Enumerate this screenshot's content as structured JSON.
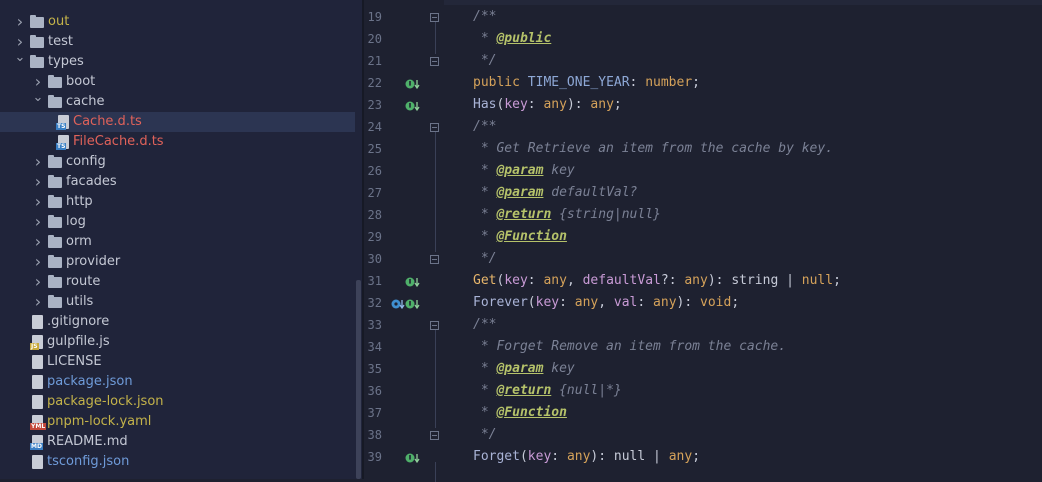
{
  "tree": {
    "items": [
      {
        "label": "out",
        "kind": "folder",
        "depth": 0,
        "expanded": false,
        "color": "#c4b34a"
      },
      {
        "label": "test",
        "kind": "folder",
        "depth": 0,
        "expanded": false,
        "color": "#c4c8d4"
      },
      {
        "label": "types",
        "kind": "folder",
        "depth": 0,
        "expanded": true,
        "color": "#c4c8d4"
      },
      {
        "label": "boot",
        "kind": "folder",
        "depth": 1,
        "expanded": false,
        "color": "#c4c8d4"
      },
      {
        "label": "cache",
        "kind": "folder",
        "depth": 1,
        "expanded": true,
        "color": "#c4c8d4"
      },
      {
        "label": "Cache.d.ts",
        "kind": "ts",
        "depth": 2,
        "color": "#e0625a",
        "selected": true
      },
      {
        "label": "FileCache.d.ts",
        "kind": "ts",
        "depth": 2,
        "color": "#e0625a"
      },
      {
        "label": "config",
        "kind": "folder",
        "depth": 1,
        "expanded": false,
        "color": "#c4c8d4"
      },
      {
        "label": "facades",
        "kind": "folder",
        "depth": 1,
        "expanded": false,
        "color": "#c4c8d4"
      },
      {
        "label": "http",
        "kind": "folder",
        "depth": 1,
        "expanded": false,
        "color": "#c4c8d4"
      },
      {
        "label": "log",
        "kind": "folder",
        "depth": 1,
        "expanded": false,
        "color": "#c4c8d4"
      },
      {
        "label": "orm",
        "kind": "folder",
        "depth": 1,
        "expanded": false,
        "color": "#c4c8d4"
      },
      {
        "label": "provider",
        "kind": "folder",
        "depth": 1,
        "expanded": false,
        "color": "#c4c8d4"
      },
      {
        "label": "route",
        "kind": "folder",
        "depth": 1,
        "expanded": false,
        "color": "#c4c8d4"
      },
      {
        "label": "utils",
        "kind": "folder",
        "depth": 1,
        "expanded": false,
        "color": "#c4c8d4"
      },
      {
        "label": ".gitignore",
        "kind": "file",
        "depth": 0,
        "color": "#c4c8d4"
      },
      {
        "label": "gulpfile.js",
        "kind": "js",
        "depth": 0,
        "color": "#c4c8d4"
      },
      {
        "label": "LICENSE",
        "kind": "file",
        "depth": 0,
        "color": "#c4c8d4"
      },
      {
        "label": "package.json",
        "kind": "json",
        "depth": 0,
        "color": "#6f9bd9"
      },
      {
        "label": "package-lock.json",
        "kind": "json",
        "depth": 0,
        "color": "#c4b34a"
      },
      {
        "label": "pnpm-lock.yaml",
        "kind": "yml",
        "depth": 0,
        "color": "#c4b34a"
      },
      {
        "label": "README.md",
        "kind": "md",
        "depth": 0,
        "color": "#c4c8d4"
      },
      {
        "label": "tsconfig.json",
        "kind": "json",
        "depth": 0,
        "color": "#6f9bd9"
      }
    ],
    "badges": {
      "ts": "TS",
      "js": "JS",
      "yml": "YML",
      "md": "MD"
    }
  },
  "editor": {
    "line_numbers": [
      "19",
      "20",
      "21",
      "22",
      "23",
      "24",
      "25",
      "26",
      "27",
      "28",
      "29",
      "30",
      "31",
      "32",
      "33",
      "34",
      "35",
      "36",
      "37",
      "38",
      "39"
    ],
    "lines": [
      [
        {
          "t": "/**",
          "c": "c-com"
        }
      ],
      [
        {
          "t": " * ",
          "c": "c-com"
        },
        {
          "t": "@public",
          "c": "c-tag"
        }
      ],
      [
        {
          "t": " */",
          "c": "c-com"
        }
      ],
      [
        {
          "t": "public ",
          "c": "c-kw"
        },
        {
          "t": "TIME_ONE_YEAR",
          "c": "c-name"
        },
        {
          "t": ": ",
          "c": "c-plain"
        },
        {
          "t": "number",
          "c": "c-type"
        },
        {
          "t": ";",
          "c": "c-plain"
        }
      ],
      [
        {
          "t": "Has",
          "c": "c-meth"
        },
        {
          "t": "(",
          "c": "c-plain"
        },
        {
          "t": "key",
          "c": "c-param"
        },
        {
          "t": ": ",
          "c": "c-plain"
        },
        {
          "t": "any",
          "c": "c-type"
        },
        {
          "t": "): ",
          "c": "c-plain"
        },
        {
          "t": "any",
          "c": "c-type"
        },
        {
          "t": ";",
          "c": "c-plain"
        }
      ],
      [
        {
          "t": "/**",
          "c": "c-com"
        }
      ],
      [
        {
          "t": " * Get Retrieve an item from the cache by key.",
          "c": "c-com"
        }
      ],
      [
        {
          "t": " * ",
          "c": "c-com"
        },
        {
          "t": "@param",
          "c": "c-tag"
        },
        {
          "t": " key",
          "c": "c-ital"
        }
      ],
      [
        {
          "t": " * ",
          "c": "c-com"
        },
        {
          "t": "@param",
          "c": "c-tag"
        },
        {
          "t": " defaultVal?",
          "c": "c-ital"
        }
      ],
      [
        {
          "t": " * ",
          "c": "c-com"
        },
        {
          "t": "@return",
          "c": "c-tag"
        },
        {
          "t": " {string|null}",
          "c": "c-ital"
        }
      ],
      [
        {
          "t": " * ",
          "c": "c-com"
        },
        {
          "t": "@Function",
          "c": "c-tag"
        }
      ],
      [
        {
          "t": " */",
          "c": "c-com"
        }
      ],
      [
        {
          "t": "Get",
          "c": "c-fn"
        },
        {
          "t": "(",
          "c": "c-plain"
        },
        {
          "t": "key",
          "c": "c-param"
        },
        {
          "t": ": ",
          "c": "c-plain"
        },
        {
          "t": "any",
          "c": "c-type"
        },
        {
          "t": ", ",
          "c": "c-plain"
        },
        {
          "t": "defaultVal",
          "c": "c-param"
        },
        {
          "t": "?: ",
          "c": "c-plain"
        },
        {
          "t": "any",
          "c": "c-type"
        },
        {
          "t": "): ",
          "c": "c-plain"
        },
        {
          "t": "string",
          "c": "c-plain"
        },
        {
          "t": " | ",
          "c": "c-plain"
        },
        {
          "t": "null",
          "c": "c-type"
        },
        {
          "t": ";",
          "c": "c-plain"
        }
      ],
      [
        {
          "t": "Forever",
          "c": "c-meth"
        },
        {
          "t": "(",
          "c": "c-plain"
        },
        {
          "t": "key",
          "c": "c-param"
        },
        {
          "t": ": ",
          "c": "c-plain"
        },
        {
          "t": "any",
          "c": "c-type"
        },
        {
          "t": ", ",
          "c": "c-plain"
        },
        {
          "t": "val",
          "c": "c-param"
        },
        {
          "t": ": ",
          "c": "c-plain"
        },
        {
          "t": "any",
          "c": "c-type"
        },
        {
          "t": "): ",
          "c": "c-plain"
        },
        {
          "t": "void",
          "c": "c-type"
        },
        {
          "t": ";",
          "c": "c-plain"
        }
      ],
      [
        {
          "t": "/**",
          "c": "c-com"
        }
      ],
      [
        {
          "t": " * Forget Remove an item from the cache.",
          "c": "c-com"
        }
      ],
      [
        {
          "t": " * ",
          "c": "c-com"
        },
        {
          "t": "@param",
          "c": "c-tag"
        },
        {
          "t": " key",
          "c": "c-ital"
        }
      ],
      [
        {
          "t": " * ",
          "c": "c-com"
        },
        {
          "t": "@return",
          "c": "c-tag"
        },
        {
          "t": " {null|*}",
          "c": "c-ital"
        }
      ],
      [
        {
          "t": " * ",
          "c": "c-com"
        },
        {
          "t": "@Function",
          "c": "c-tag"
        }
      ],
      [
        {
          "t": " */",
          "c": "c-com"
        }
      ],
      [
        {
          "t": "Forget",
          "c": "c-meth"
        },
        {
          "t": "(",
          "c": "c-plain"
        },
        {
          "t": "key",
          "c": "c-param"
        },
        {
          "t": ": ",
          "c": "c-plain"
        },
        {
          "t": "any",
          "c": "c-type"
        },
        {
          "t": "): ",
          "c": "c-plain"
        },
        {
          "t": "null",
          "c": "c-plain"
        },
        {
          "t": " | ",
          "c": "c-plain"
        },
        {
          "t": "any",
          "c": "c-type"
        },
        {
          "t": ";",
          "c": "c-plain"
        }
      ]
    ],
    "gutter_icons": [
      {
        "line": "22",
        "icon": "implemented-icon"
      },
      {
        "line": "23",
        "icon": "implemented-icon"
      },
      {
        "line": "31",
        "icon": "implemented-icon"
      },
      {
        "line": "32",
        "icon": "override-implemented-icon"
      },
      {
        "line": "39",
        "icon": "implemented-icon"
      }
    ],
    "fold_marks": [
      "19",
      "21",
      "24",
      "30",
      "33",
      "38"
    ]
  }
}
